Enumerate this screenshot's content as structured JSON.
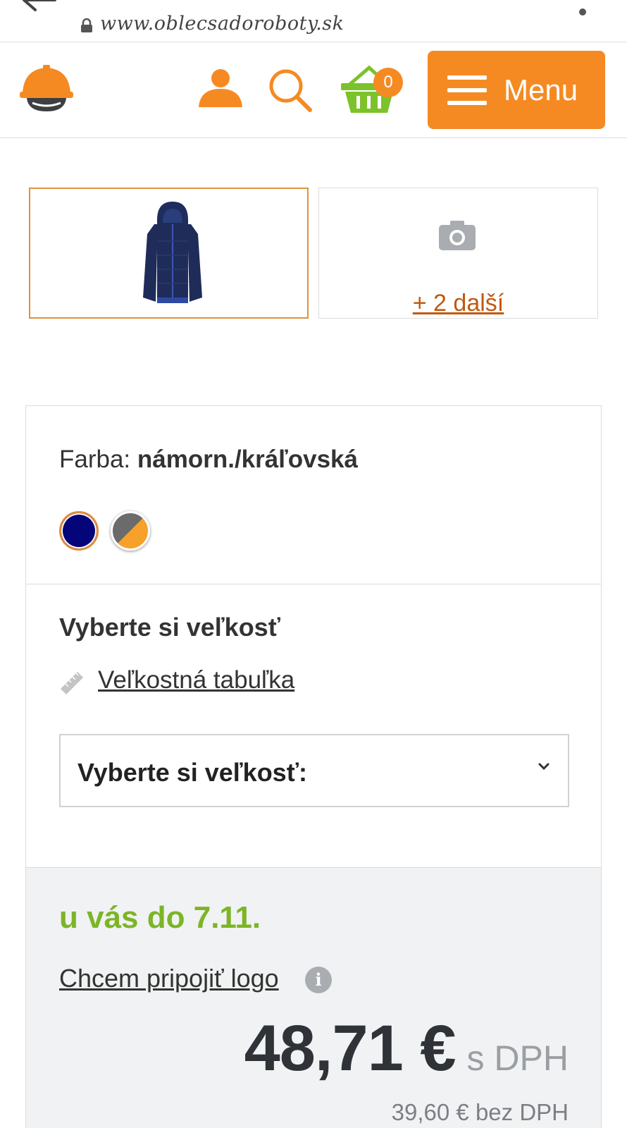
{
  "browser": {
    "url": "www.oblecsadoroboty.sk"
  },
  "header": {
    "cart_count": "0",
    "menu_label": "Menu",
    "brand_color": "#f58a23",
    "cart_color": "#7cc22a"
  },
  "gallery": {
    "more_link": "+ 2 další"
  },
  "color": {
    "label": "Farba:",
    "selected": "námorn./kráľovská",
    "swatches": [
      {
        "name": "námorn./kráľovská",
        "colors": [
          "#05057a"
        ],
        "selected": true
      },
      {
        "name": "grey/orange",
        "colors": [
          "#6b6b6b",
          "#f7a12a"
        ],
        "selected": false
      }
    ]
  },
  "size": {
    "heading": "Vyberte si veľkosť",
    "chart_link": "Veľkostná tabuľka",
    "select_value": "Vyberte si veľkosť:"
  },
  "price": {
    "delivery": "u vás do 7.11.",
    "logo_link": "Chcem pripojiť logo",
    "value": "48,71 €",
    "suffix": "s DPH",
    "net": "39,60 € bez DPH",
    "delivery_color": "#7cb527"
  }
}
